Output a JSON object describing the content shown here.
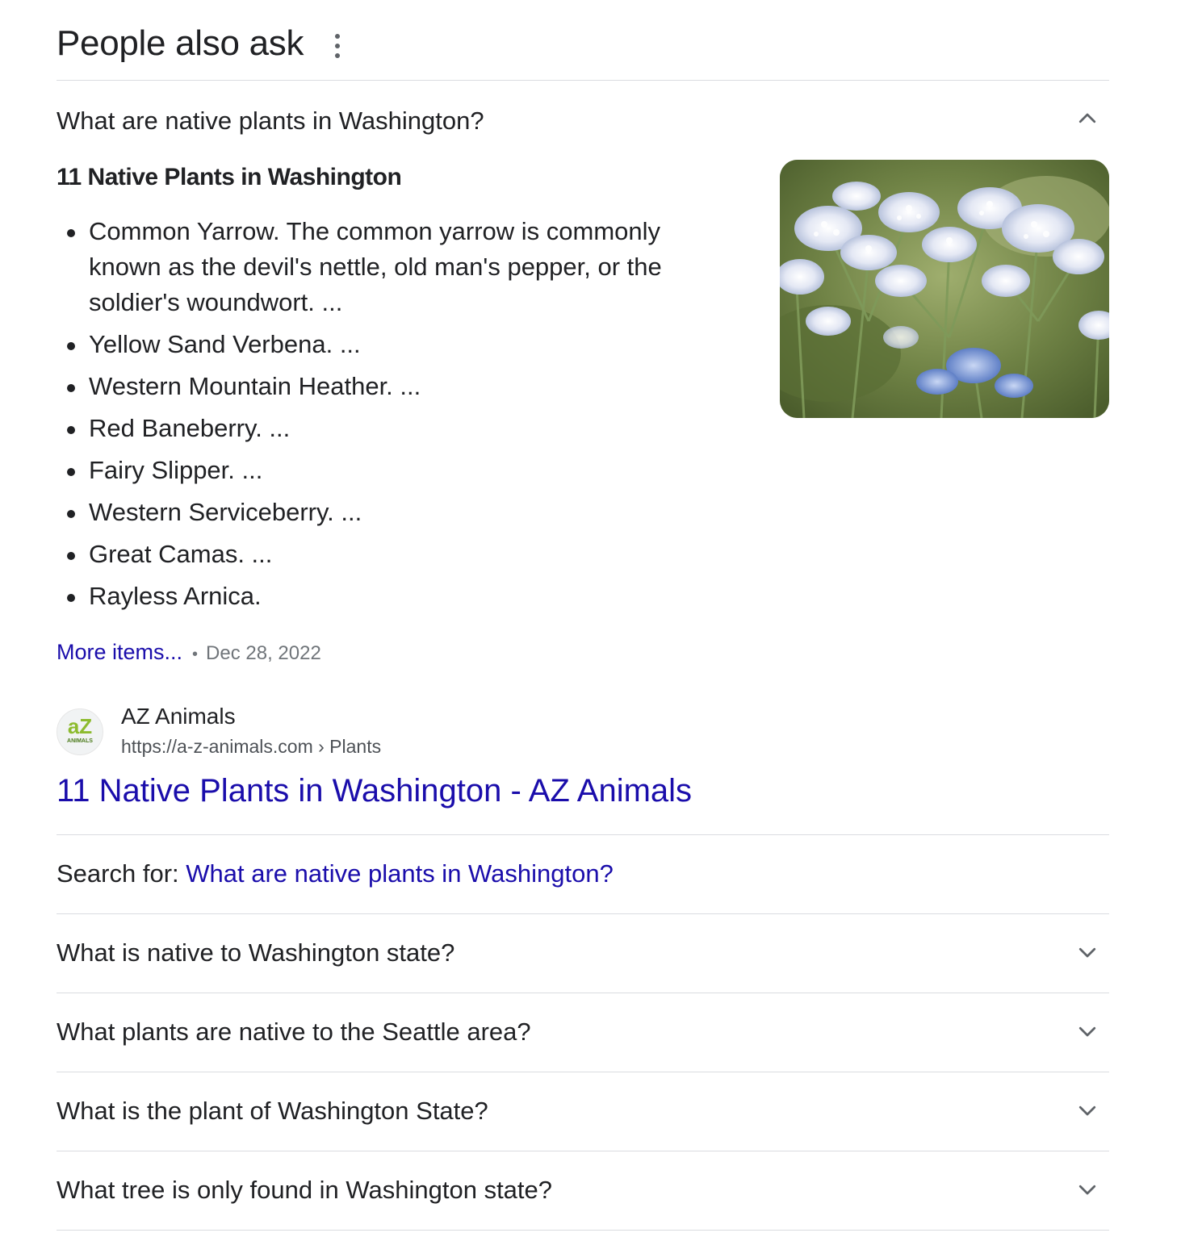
{
  "header": {
    "title": "People also ask"
  },
  "open_question": {
    "text": "What are native plants in Washington?",
    "answer_heading": "11 Native Plants in Washington",
    "items": [
      "Common Yarrow. The common yarrow is commonly known as the devil's nettle, old man's pepper, or the soldier's woundwort. ...",
      "Yellow Sand Verbena. ...",
      "Western Mountain Heather. ...",
      "Red Baneberry. ...",
      "Fairy Slipper. ...",
      "Western Serviceberry. ...",
      "Great Camas. ...",
      "Rayless Arnica."
    ],
    "more_items_label": "More items...",
    "separator": "•",
    "date": "Dec 28, 2022",
    "source": {
      "favicon_text": "aZ",
      "favicon_subtext": "ANIMALS",
      "site_name": "AZ Animals",
      "url": "https://a-z-animals.com › Plants",
      "title": "11 Native Plants in Washington - AZ Animals"
    },
    "search_for_label": "Search for: ",
    "search_for_query": "What are native plants in Washington?"
  },
  "other_questions": [
    "What is native to Washington state?",
    "What plants are native to the Seattle area?",
    "What is the plant of Washington State?",
    "What tree is only found in Washington state?"
  ],
  "colors": {
    "link": "#1a0dab",
    "text": "#202124",
    "muted": "#70757a",
    "divider": "#dadce0"
  }
}
